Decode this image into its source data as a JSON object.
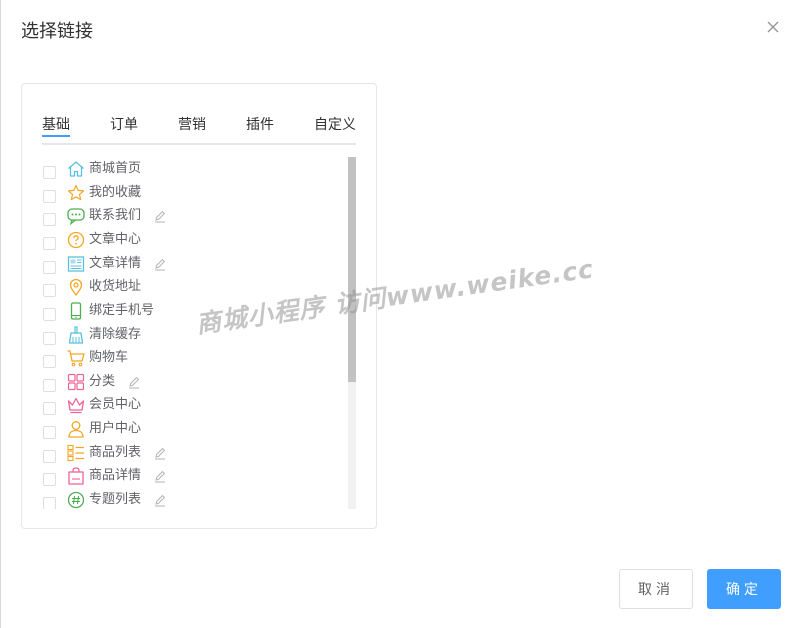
{
  "dialog": {
    "title": "选择链接"
  },
  "tabs": [
    {
      "label": "基础",
      "active": true
    },
    {
      "label": "订单",
      "active": false
    },
    {
      "label": "营销",
      "active": false
    },
    {
      "label": "插件",
      "active": false
    },
    {
      "label": "自定义",
      "active": false
    }
  ],
  "links": [
    {
      "label": "商城首页",
      "icon": "home-icon",
      "editable": false,
      "checked": false
    },
    {
      "label": "我的收藏",
      "icon": "star-icon",
      "editable": false,
      "checked": false
    },
    {
      "label": "联系我们",
      "icon": "chat-bubble-icon",
      "editable": true,
      "checked": false
    },
    {
      "label": "文章中心",
      "icon": "question-circle-icon",
      "editable": false,
      "checked": false
    },
    {
      "label": "文章详情",
      "icon": "article-icon",
      "editable": true,
      "checked": false
    },
    {
      "label": "收货地址",
      "icon": "location-pin-icon",
      "editable": false,
      "checked": false
    },
    {
      "label": "绑定手机号",
      "icon": "mobile-phone-icon",
      "editable": false,
      "checked": false
    },
    {
      "label": "清除缓存",
      "icon": "broom-icon",
      "editable": false,
      "checked": false
    },
    {
      "label": "购物车",
      "icon": "cart-icon",
      "editable": false,
      "checked": false
    },
    {
      "label": "分类",
      "icon": "grid-category-icon",
      "editable": true,
      "checked": false
    },
    {
      "label": "会员中心",
      "icon": "crown-icon",
      "editable": false,
      "checked": false
    },
    {
      "label": "用户中心",
      "icon": "user-icon",
      "editable": false,
      "checked": false
    },
    {
      "label": "商品列表",
      "icon": "list-icon",
      "editable": true,
      "checked": false
    },
    {
      "label": "商品详情",
      "icon": "shopping-bag-icon",
      "editable": true,
      "checked": false
    },
    {
      "label": "专题列表",
      "icon": "hashtag-icon",
      "editable": true,
      "checked": false
    }
  ],
  "scroll": {
    "visible_fraction": 0.64,
    "position": 0
  },
  "watermark": {
    "text": "商城小程序  访问www.weike.cc"
  },
  "footer": {
    "cancel_label": "取消",
    "confirm_label": "确定"
  },
  "colors": {
    "accent": "#409eff",
    "home": "#5bc0de",
    "star": "#f5a623",
    "chat": "#4caf50",
    "question": "#f5a623",
    "article": "#5bc0de",
    "location": "#f5a623",
    "mobile": "#4caf50",
    "broom": "#5bc0de",
    "cart": "#f5a623",
    "category": "#f06292",
    "crown": "#f06292",
    "user": "#f5a623",
    "list": "#f5a623",
    "bag": "#f06292",
    "hashtag": "#4caf50"
  }
}
